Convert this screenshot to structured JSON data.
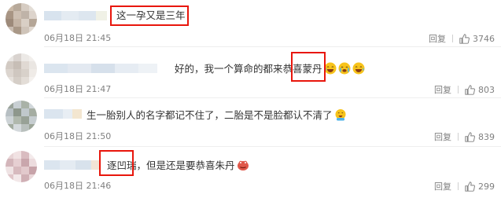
{
  "comments": [
    {
      "text": "这一孕又是三年",
      "time": "06月18日 21:45",
      "reply": "回复",
      "likes": "3746"
    },
    {
      "text": "好的，我一个算命的都来恭喜蒙丹",
      "time": "06月18日 21:47",
      "reply": "回复",
      "likes": "803"
    },
    {
      "text": "生一胎别人的名字都记不住了，二胎是不是脸都认不清了",
      "time": "06月18日 21:50",
      "reply": "回复",
      "likes": "839"
    },
    {
      "text": "逐凹瑞，但是还是要恭喜朱丹",
      "time": "06月18日 21:46",
      "reply": "回复",
      "likes": "299"
    }
  ],
  "icons": {
    "like": "thumbs-up-icon",
    "emoji_laugh": "laughing-face-icon",
    "emoji_cry": "crying-face-icon"
  },
  "colors": {
    "highlight_border": "#e8160c",
    "meta_text": "#808080"
  }
}
